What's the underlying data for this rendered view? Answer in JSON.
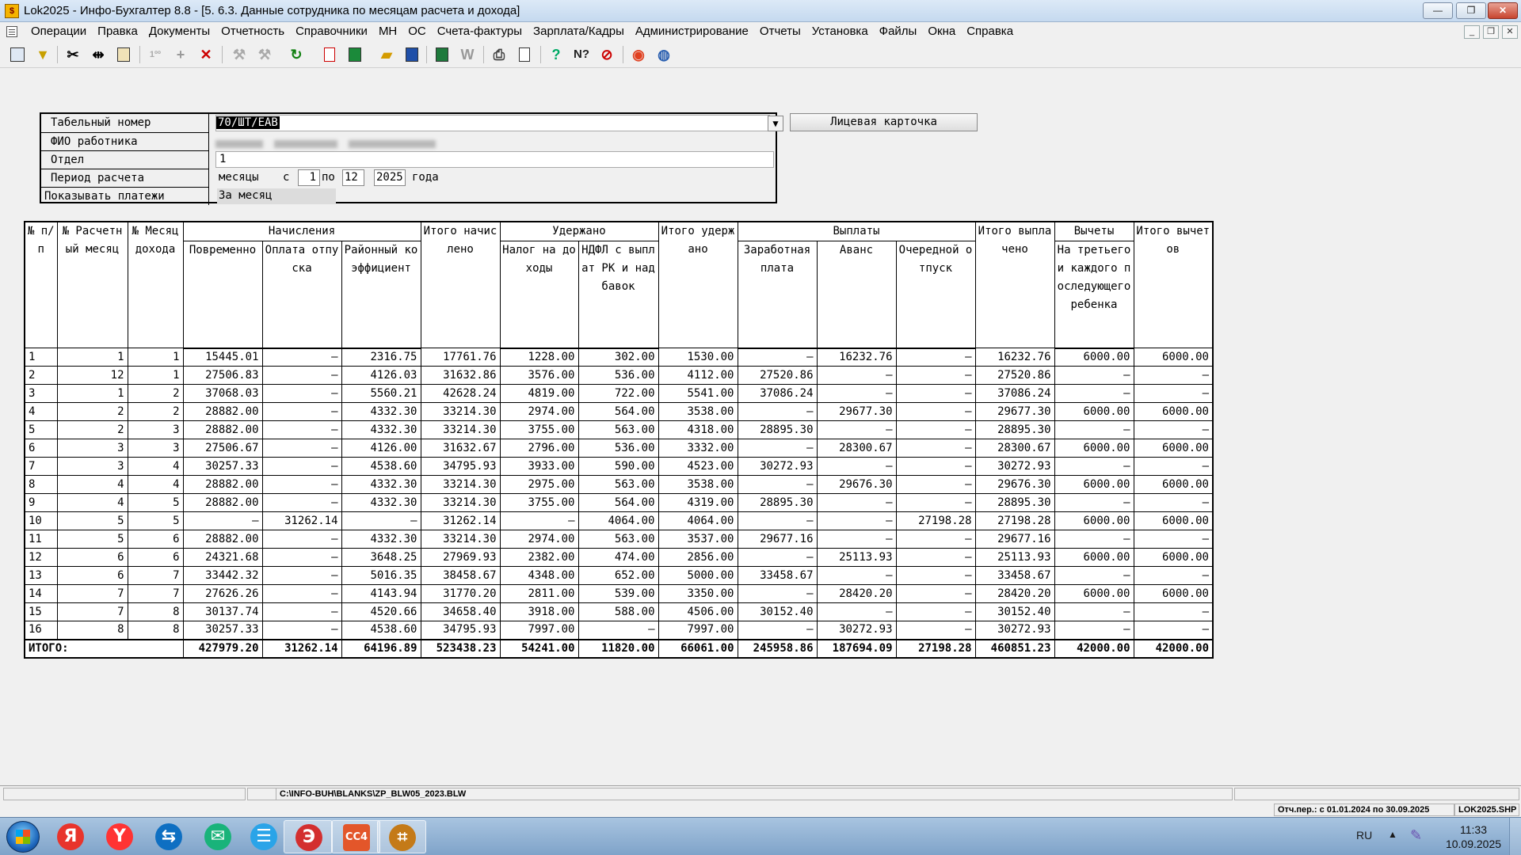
{
  "window": {
    "title": "Lok2025 - Инфо-Бухгалтер 8.8 - [5. 6.3. Данные сотрудника по месяцам расчета и дохода]",
    "minimize": "—",
    "restore": "❐",
    "close": "✕"
  },
  "menu": [
    "Операции",
    "Правка",
    "Документы",
    "Отчетность",
    "Справочники",
    "МН",
    "ОС",
    "Счета-фактуры",
    "Зарплата/Кадры",
    "Администрирование",
    "Отчеты",
    "Установка",
    "Файлы",
    "Окна",
    "Справка"
  ],
  "mdi_controls": {
    "minimize": "_",
    "restore": "❐",
    "close": "✕"
  },
  "toolbar_icons": [
    "report-grid-icon",
    "filter-icon",
    "cut-icon",
    "column-width-icon",
    "paste-icon",
    "counter-icon",
    "add-icon",
    "delete-icon",
    "tool-disabled-icon",
    "tool-disabled-icon-2",
    "refresh-icon",
    "document-icon",
    "calculator-icon",
    "open-folder-icon",
    "save-icon",
    "excel-icon",
    "word-icon",
    "print-icon",
    "preview-icon",
    "help-icon",
    "context-help-icon",
    "navigator-icon",
    "support-icon",
    "web-icon"
  ],
  "form": {
    "tab_label": "Табельный номер",
    "tab_value": "70/ШТ/ЕАВ",
    "fio_label": "ФИО работника",
    "dept_label": "Отдел",
    "dept_value": "1",
    "period_label": "Период расчета",
    "period_word": "месяцы",
    "period_from_label": "с",
    "period_from": "1",
    "period_to_label": "по",
    "period_to": "12",
    "period_year": "2025",
    "period_year_suffix": "года",
    "show_label": "Показывать платежи",
    "show_value": "За месяц",
    "card_button": "Лицевая карточка"
  },
  "table": {
    "groups": {
      "n": "№ п/п",
      "calc_month": "№ Расчетный месяц",
      "income_month": "№ Месяц дохода",
      "accruals": "Начисления",
      "total_accrued": "Итого начислено",
      "withheld": "Удержано",
      "total_withheld": "Итого удержано",
      "payments": "Выплаты",
      "total_paid": "Итого выплачено",
      "deductions": "Вычеты",
      "total_deductions": "Итого вычетов"
    },
    "sub": {
      "piece": "Повременно",
      "vacation": "Оплата отпуска",
      "district": "Районный коэффициент",
      "tax": "Налог на доходы",
      "ndfl_rk": "НДФЛ с выплат РК и надбавок",
      "salary": "Заработная плата",
      "advance": "Аванс",
      "next_vacation": "Очередной отпуск",
      "child3": "На третьего и каждого последующего ребенка"
    },
    "rows": [
      [
        "1",
        "1",
        "1",
        "15445.01",
        "–",
        "2316.75",
        "17761.76",
        "1228.00",
        "302.00",
        "1530.00",
        "–",
        "16232.76",
        "–",
        "16232.76",
        "6000.00",
        "6000.00"
      ],
      [
        "2",
        "12",
        "1",
        "27506.83",
        "–",
        "4126.03",
        "31632.86",
        "3576.00",
        "536.00",
        "4112.00",
        "27520.86",
        "–",
        "–",
        "27520.86",
        "–",
        "–"
      ],
      [
        "3",
        "1",
        "2",
        "37068.03",
        "–",
        "5560.21",
        "42628.24",
        "4819.00",
        "722.00",
        "5541.00",
        "37086.24",
        "–",
        "–",
        "37086.24",
        "–",
        "–"
      ],
      [
        "4",
        "2",
        "2",
        "28882.00",
        "–",
        "4332.30",
        "33214.30",
        "2974.00",
        "564.00",
        "3538.00",
        "–",
        "29677.30",
        "–",
        "29677.30",
        "6000.00",
        "6000.00"
      ],
      [
        "5",
        "2",
        "3",
        "28882.00",
        "–",
        "4332.30",
        "33214.30",
        "3755.00",
        "563.00",
        "4318.00",
        "28895.30",
        "–",
        "–",
        "28895.30",
        "–",
        "–"
      ],
      [
        "6",
        "3",
        "3",
        "27506.67",
        "–",
        "4126.00",
        "31632.67",
        "2796.00",
        "536.00",
        "3332.00",
        "–",
        "28300.67",
        "–",
        "28300.67",
        "6000.00",
        "6000.00"
      ],
      [
        "7",
        "3",
        "4",
        "30257.33",
        "–",
        "4538.60",
        "34795.93",
        "3933.00",
        "590.00",
        "4523.00",
        "30272.93",
        "–",
        "–",
        "30272.93",
        "–",
        "–"
      ],
      [
        "8",
        "4",
        "4",
        "28882.00",
        "–",
        "4332.30",
        "33214.30",
        "2975.00",
        "563.00",
        "3538.00",
        "–",
        "29676.30",
        "–",
        "29676.30",
        "6000.00",
        "6000.00"
      ],
      [
        "9",
        "4",
        "5",
        "28882.00",
        "–",
        "4332.30",
        "33214.30",
        "3755.00",
        "564.00",
        "4319.00",
        "28895.30",
        "–",
        "–",
        "28895.30",
        "–",
        "–"
      ],
      [
        "10",
        "5",
        "5",
        "–",
        "31262.14",
        "–",
        "31262.14",
        "–",
        "4064.00",
        "4064.00",
        "–",
        "–",
        "27198.28",
        "27198.28",
        "6000.00",
        "6000.00"
      ],
      [
        "11",
        "5",
        "6",
        "28882.00",
        "–",
        "4332.30",
        "33214.30",
        "2974.00",
        "563.00",
        "3537.00",
        "29677.16",
        "–",
        "–",
        "29677.16",
        "–",
        "–"
      ],
      [
        "12",
        "6",
        "6",
        "24321.68",
        "–",
        "3648.25",
        "27969.93",
        "2382.00",
        "474.00",
        "2856.00",
        "–",
        "25113.93",
        "–",
        "25113.93",
        "6000.00",
        "6000.00"
      ],
      [
        "13",
        "6",
        "7",
        "33442.32",
        "–",
        "5016.35",
        "38458.67",
        "4348.00",
        "652.00",
        "5000.00",
        "33458.67",
        "–",
        "–",
        "33458.67",
        "–",
        "–"
      ],
      [
        "14",
        "7",
        "7",
        "27626.26",
        "–",
        "4143.94",
        "31770.20",
        "2811.00",
        "539.00",
        "3350.00",
        "–",
        "28420.20",
        "–",
        "28420.20",
        "6000.00",
        "6000.00"
      ],
      [
        "15",
        "7",
        "8",
        "30137.74",
        "–",
        "4520.66",
        "34658.40",
        "3918.00",
        "588.00",
        "4506.00",
        "30152.40",
        "–",
        "–",
        "30152.40",
        "–",
        "–"
      ],
      [
        "16",
        "8",
        "8",
        "30257.33",
        "–",
        "4538.60",
        "34795.93",
        "7997.00",
        "–",
        "7997.00",
        "–",
        "30272.93",
        "–",
        "30272.93",
        "–",
        "–"
      ]
    ],
    "total_label": "ИТОГО:",
    "totals": [
      "427979.20",
      "31262.14",
      "64196.89",
      "523438.23",
      "54241.00",
      "11820.00",
      "66061.00",
      "245958.86",
      "187694.09",
      "27198.28",
      "460851.23",
      "42000.00",
      "42000.00"
    ]
  },
  "status": {
    "blank_path": "C:\\INFO-BUH\\BLANKS\\ZP_BLW05_2023.BLW",
    "report_period": "Отч.пер.: с 01.01.2024 по 30.09.2025",
    "shp": "LOK2025.SHP"
  },
  "taskbar": {
    "apps": [
      {
        "name": "yandex-icon",
        "glyph": "Я",
        "color": "#e8342c"
      },
      {
        "name": "yandex-browser-icon",
        "glyph": "Y",
        "color": "#f33"
      },
      {
        "name": "teamviewer-icon",
        "glyph": "⇆",
        "color": "#0e6fc2"
      },
      {
        "name": "messenger-icon",
        "glyph": "✉",
        "color": "#19b37a"
      },
      {
        "name": "chat-icon",
        "glyph": "☰",
        "color": "#2aa4e8"
      },
      {
        "name": "accounting-e-icon",
        "glyph": "Э",
        "color": "#d32f2f"
      },
      {
        "name": "cc4-icon",
        "glyph": "CC4",
        "color": "#e3562a"
      },
      {
        "name": "abacus-icon",
        "glyph": "⌗",
        "color": "#c47a18"
      }
    ],
    "lang": "RU",
    "time": "11:33",
    "date": "10.09.2025"
  }
}
